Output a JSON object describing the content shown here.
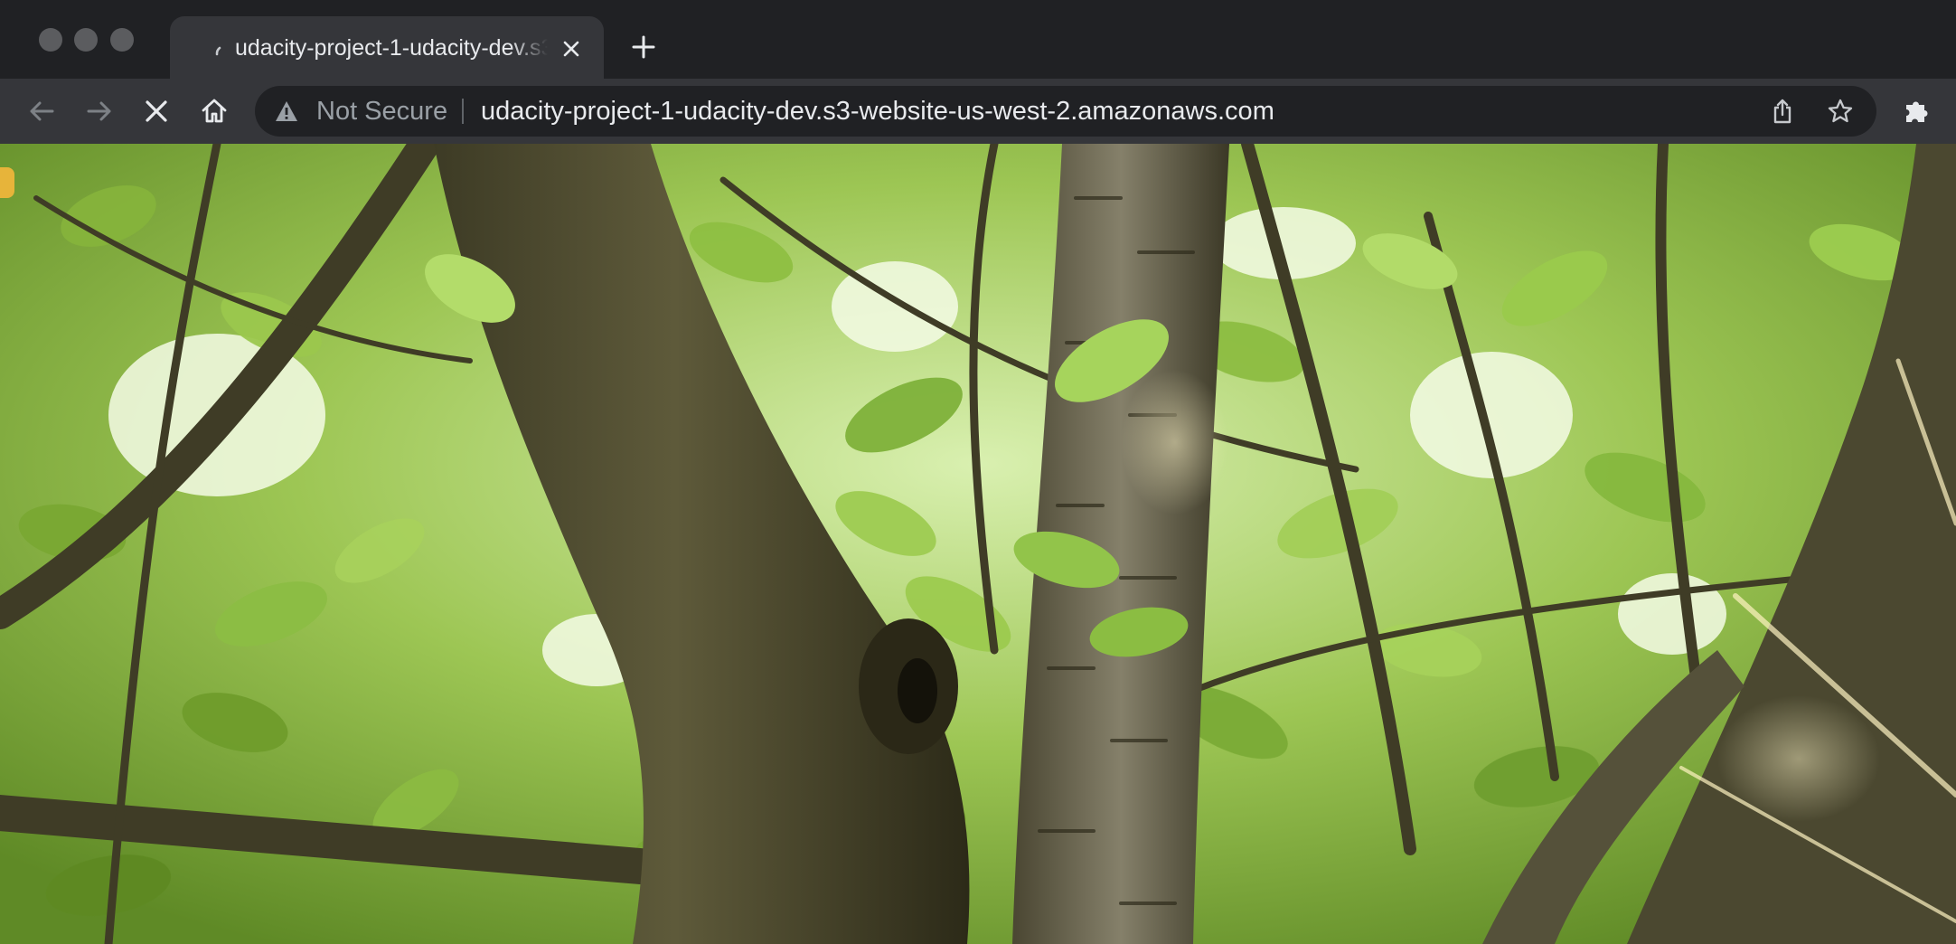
{
  "window": {
    "traffic_lights": [
      "close",
      "minimize",
      "zoom"
    ]
  },
  "tab": {
    "title": "udacity-project-1-udacity-dev.s3-website-us-west-2.amazonaws.com",
    "loading": true,
    "close_icon": "close-icon"
  },
  "tabstrip": {
    "new_tab_icon": "plus-icon"
  },
  "toolbar": {
    "back_icon": "arrow-left-icon",
    "forward_icon": "arrow-right-icon",
    "stop_icon": "close-icon",
    "home_icon": "home-icon",
    "extensions_icon": "puzzle-icon"
  },
  "omnibox": {
    "security_label": "Not Secure",
    "security_icon": "warning-triangle-icon",
    "url": "udacity-project-1-udacity-dev.s3-website-us-west-2.amazonaws.com",
    "share_icon": "share-icon",
    "bookmark_icon": "star-icon"
  },
  "colors": {
    "chrome_dark": "#202124",
    "toolbar": "#35363a",
    "text": "#e8eaed",
    "muted_text": "#9aa0a6",
    "leaf_green": "#7fb23a",
    "bark": "#4e4b2f"
  }
}
